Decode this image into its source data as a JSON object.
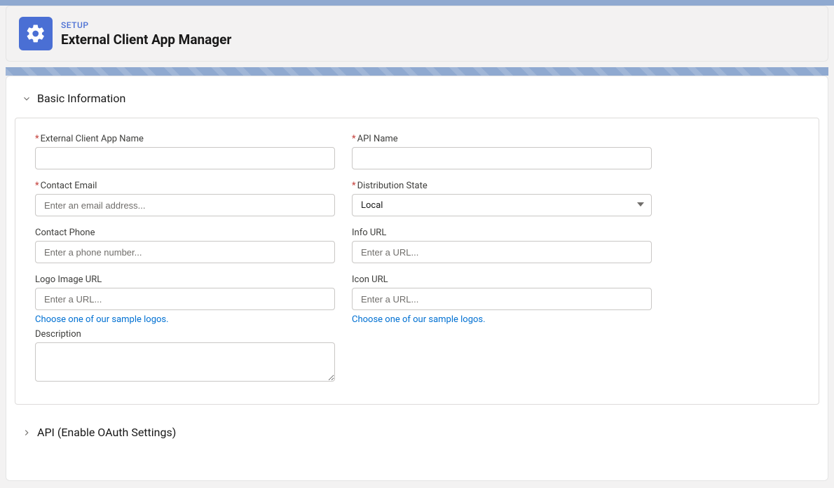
{
  "header": {
    "overline": "SETUP",
    "title": "External Client App Manager"
  },
  "sections": {
    "basic_info": {
      "title": "Basic Information"
    },
    "api": {
      "title": "API (Enable OAuth Settings)"
    }
  },
  "form": {
    "app_name": {
      "label": "External Client App Name",
      "value": ""
    },
    "api_name": {
      "label": "API Name",
      "value": ""
    },
    "contact_email": {
      "label": "Contact Email",
      "placeholder": "Enter an email address...",
      "value": ""
    },
    "distribution_state": {
      "label": "Distribution State",
      "selected": "Local"
    },
    "contact_phone": {
      "label": "Contact Phone",
      "placeholder": "Enter a phone number...",
      "value": ""
    },
    "info_url": {
      "label": "Info URL",
      "placeholder": "Enter a URL...",
      "value": ""
    },
    "logo_url": {
      "label": "Logo Image URL",
      "placeholder": "Enter a URL...",
      "value": "",
      "help": "Choose one of our sample logos."
    },
    "icon_url": {
      "label": "Icon URL",
      "placeholder": "Enter a URL...",
      "value": "",
      "help": "Choose one of our sample logos."
    },
    "description": {
      "label": "Description",
      "value": ""
    }
  }
}
